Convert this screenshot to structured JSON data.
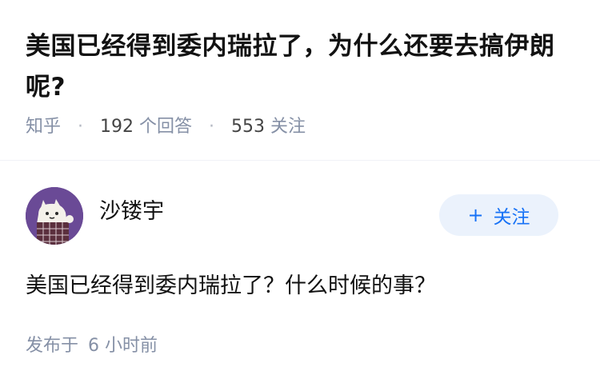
{
  "question": {
    "title": "美国已经得到委内瑞拉了，为什么还要去搞伊朗呢?",
    "source": "知乎",
    "answer_count": "192",
    "answer_label": "个回答",
    "follower_count": "553",
    "follower_label": "关注",
    "separator": "·"
  },
  "answer": {
    "author_name": "沙镂宇",
    "follow_button_label": "关注",
    "follow_button_icon": "plus-icon",
    "text": "美国已经得到委内瑞拉了？什么时候的事？",
    "posted_label": "发布于",
    "posted_time": "6 小时前"
  },
  "colors": {
    "accent": "#1772f6",
    "follow_button_bg": "#ebf2fc",
    "meta_text": "#8590a6",
    "avatar_bg": "#6a4a96"
  }
}
